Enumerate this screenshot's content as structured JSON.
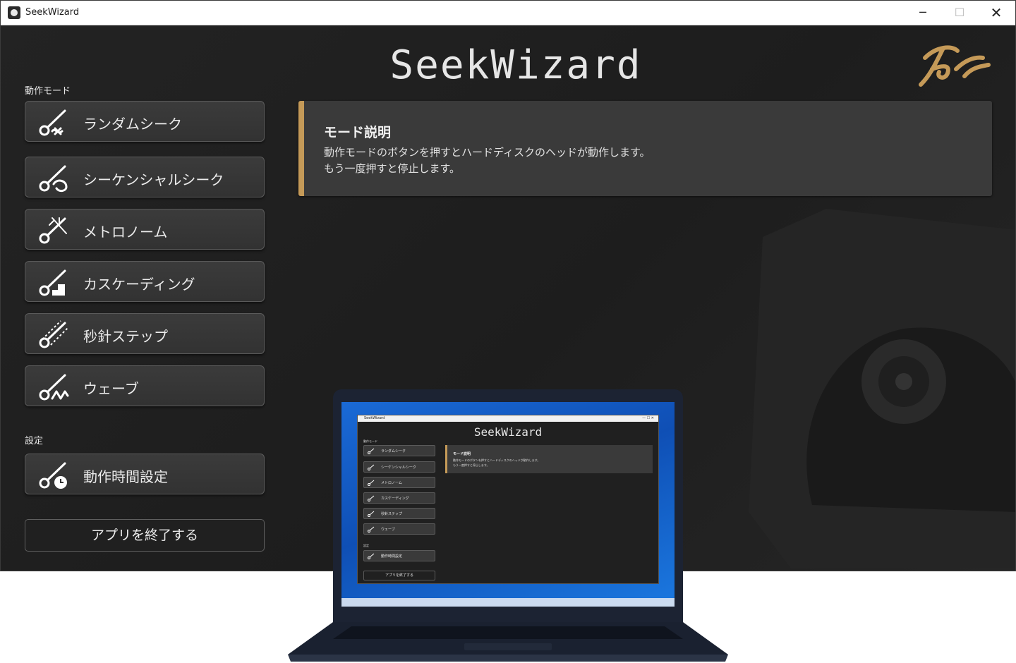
{
  "window": {
    "title": "SeekWizard",
    "controls": {
      "minimize": "─",
      "maximize": "☐",
      "close": "✕"
    }
  },
  "header": {
    "brand": "SeekWizard",
    "logo_icon": "goa-logo-icon"
  },
  "sections": {
    "mode": "動作モード",
    "settings": "設定"
  },
  "mode_buttons": [
    {
      "label": "ランダムシーク",
      "icon": "random-seek-icon"
    },
    {
      "label": "シーケンシャルシーク",
      "icon": "sequential-seek-icon"
    },
    {
      "label": "メトロノーム",
      "icon": "metronome-icon"
    },
    {
      "label": "カスケーディング",
      "icon": "cascading-icon"
    },
    {
      "label": "秒針ステップ",
      "icon": "second-hand-step-icon"
    },
    {
      "label": "ウェーブ",
      "icon": "wave-icon"
    }
  ],
  "settings_buttons": [
    {
      "label": "動作時間設定",
      "icon": "timer-icon"
    }
  ],
  "exit_button": "アプリを終了する",
  "description": {
    "title": "モード説明",
    "lines": [
      "動作モードのボタンを押すとハードディスクのヘッドが動作します。",
      "もう一度押すと停止します。"
    ]
  },
  "colors": {
    "accent": "#c59a58",
    "background": "#202020",
    "button": "#383838"
  }
}
